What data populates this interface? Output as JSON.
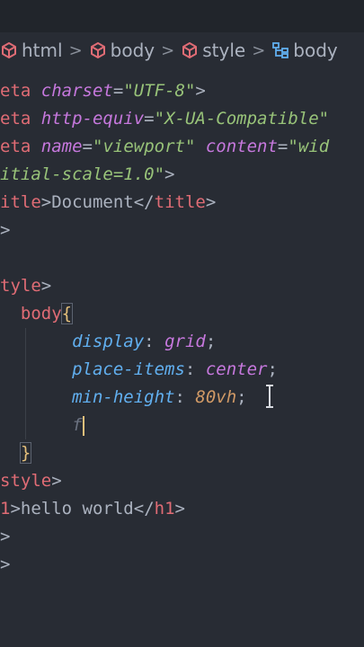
{
  "breadcrumb": {
    "items": [
      {
        "label": "html",
        "icon": "cube-icon"
      },
      {
        "label": "body",
        "icon": "cube-icon"
      },
      {
        "label": "style",
        "icon": "cube-icon"
      },
      {
        "label": "body",
        "icon": "css-selector-icon"
      }
    ],
    "separator": ">"
  },
  "code": {
    "l1": {
      "tag": "eta",
      "attr": "charset",
      "eq": "=",
      "str": "\"UTF-8\"",
      "end": ">"
    },
    "l2": {
      "tag": "eta",
      "attr": "http-equiv",
      "eq": "=",
      "str": "\"X-UA-Compatible\""
    },
    "l3": {
      "tag": "eta",
      "attr": "name",
      "eq": "=",
      "str": "\"viewport\"",
      "attr2": "content",
      "eq2": "=",
      "str2": "\"wid"
    },
    "l4": {
      "str": "itial-scale=1.0\"",
      "end": ">"
    },
    "l5": {
      "tag": "itle",
      "gt": ">",
      "text": "Document",
      "close_open": "</",
      "close_tag": "title",
      "close_end": ">"
    },
    "l6": {
      "end": ">"
    },
    "l8": {
      "tag": "tyle",
      "end": ">"
    },
    "l9": {
      "sel": "body",
      "brace": "{"
    },
    "l10": {
      "prop": "display",
      "colon": ":",
      "val": "grid",
      "semi": ";"
    },
    "l11": {
      "prop": "place-items",
      "colon": ":",
      "val": "center",
      "semi": ";"
    },
    "l12": {
      "prop": "min-height",
      "colon": ":",
      "num": "80vh",
      "semi": ";"
    },
    "l13": {
      "typed": "f"
    },
    "l14": {
      "brace": "}"
    },
    "l15": {
      "tag": "style",
      "end": ">"
    },
    "l16": {
      "tag": "1",
      "gt": ">",
      "text": "hello world",
      "close_open": "</",
      "close_tag": "h1",
      "close_end": ">"
    },
    "l17": {
      "end": ">"
    },
    "l18": {
      "end": ">"
    }
  },
  "colors": {
    "background": "#282c34",
    "tag": "#e06c75",
    "attribute": "#c678dd",
    "string": "#98c379",
    "property": "#61afef",
    "number": "#d19a66",
    "brace": "#e5c07b"
  }
}
